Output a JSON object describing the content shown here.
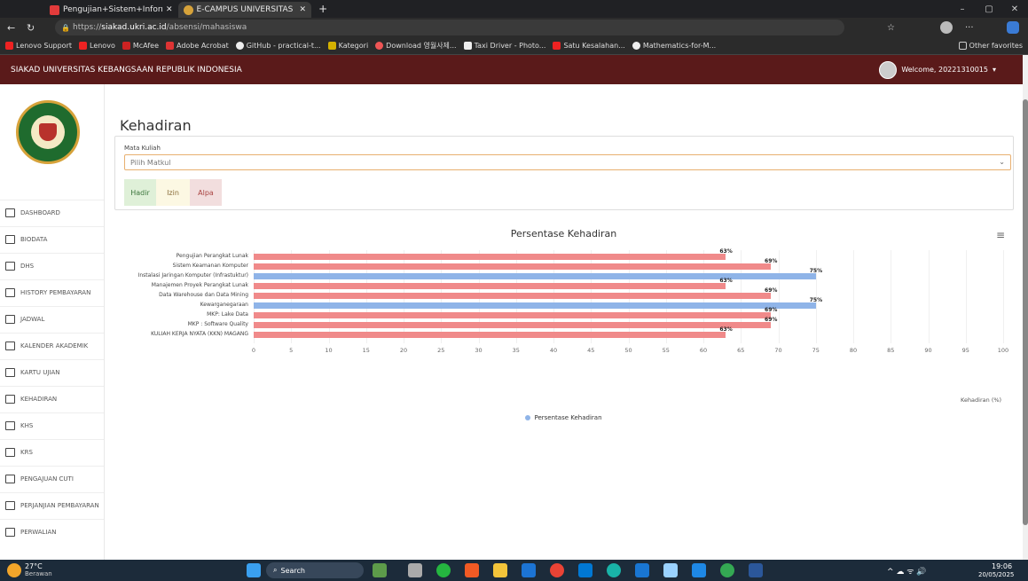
{
  "browser": {
    "tabs": [
      {
        "label": "Pengujian+Sistem+Informasi+Al...",
        "active": false
      },
      {
        "label": "E-CAMPUS UNIVERSITAS KEBANG...",
        "active": true
      }
    ],
    "new_tab": "+",
    "url_prefix": "https://",
    "url_domain": "siakad.ukri.ac.id",
    "url_path": "/absensi/mahasiswa",
    "favorites": [
      "Lenovo Support",
      "Lenovo",
      "McAfee",
      "Adobe Acrobat",
      "GitHub - practical-t...",
      "Kategori",
      "Download 영월사제...",
      "Taxi Driver - Photo...",
      "Satu Kesalahan...",
      "Mathematics-for-M..."
    ],
    "other_favorites": "Other favorites"
  },
  "site": {
    "title": "SIAKAD UNIVERSITAS KEBANGSAAN REPUBLIK INDONESIA",
    "welcome": "Welcome, 20221310015"
  },
  "sidebar": {
    "items": [
      "DASHBOARD",
      "BIODATA",
      "DHS",
      "HISTORY PEMBAYARAN",
      "JADWAL",
      "KALENDER AKADEMIK",
      "KARTU UJIAN",
      "KEHADIRAN",
      "KHS",
      "KRS",
      "PENGAJUAN CUTI",
      "PERJANJIAN PEMBAYARAN",
      "PERWALIAN"
    ]
  },
  "page": {
    "title": "Kehadiran",
    "select_label": "Mata Kuliah",
    "select_value": "Pilih Matkul",
    "legend_hadir": "Hadir",
    "legend_izin": "Izin",
    "legend_alpa": "Alpa"
  },
  "chart_data": {
    "type": "bar",
    "orientation": "horizontal",
    "title": "Persentase Kehadiran",
    "xlabel": "Kehadiran (%)",
    "xlim": [
      0,
      100
    ],
    "ticks": [
      0,
      5,
      10,
      15,
      20,
      25,
      30,
      35,
      40,
      45,
      50,
      55,
      60,
      65,
      70,
      75,
      80,
      85,
      90,
      95,
      100
    ],
    "categories": [
      "Pengujian Perangkat Lunak",
      "Sistem Keamanan Komputer",
      "Instalasi Jaringan Komputer (Infrastuktur)",
      "Manajemen Proyek Perangkat Lunak",
      "Data Warehouse dan Data Mining",
      "Kewarganegaraan",
      "MKP: Lake Data",
      "MKP : Software Quality",
      "KULIAH KERJA NYATA (KKN) MAGANG"
    ],
    "values": [
      63,
      69,
      75,
      63,
      69,
      75,
      69,
      69,
      63
    ],
    "data_labels": [
      "63%",
      "69%",
      "75%",
      "63%",
      "69%",
      "75%",
      "69%",
      "69%",
      "63%"
    ],
    "bar_colors": [
      "#f08a8a",
      "#f08a8a",
      "#8fb4e8",
      "#f08a8a",
      "#f08a8a",
      "#8fb4e8",
      "#f08a8a",
      "#f08a8a",
      "#f08a8a"
    ],
    "legend": [
      "Persentase Kehadiran"
    ]
  },
  "taskbar": {
    "temp": "27°C",
    "weather": "Berawan",
    "search": "Search",
    "time": "19:06",
    "date": "20/05/2025"
  }
}
